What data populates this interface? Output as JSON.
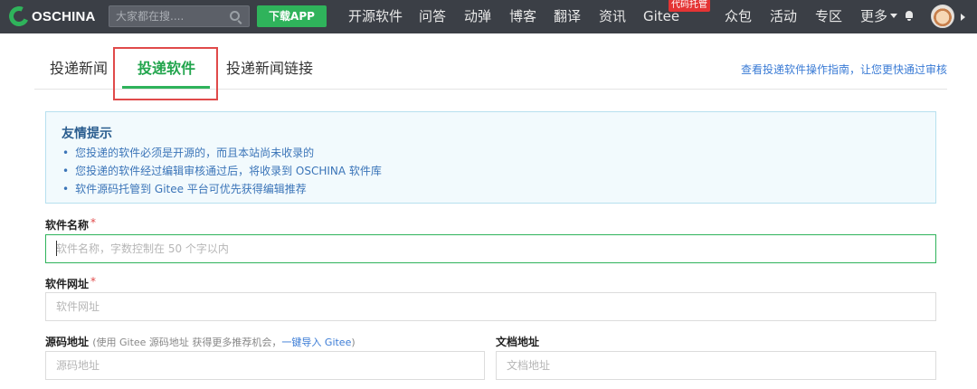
{
  "topnav": {
    "logo_text": "OSCHINA",
    "search_placeholder": "大家都在搜....",
    "download_label": "下载APP",
    "items": [
      "开源软件",
      "问答",
      "动弹",
      "博客",
      "翻译",
      "资讯",
      "Gitee",
      "众包",
      "活动",
      "专区",
      "更多"
    ],
    "gitee_badge": "代码托管"
  },
  "tabs": {
    "items": [
      "投递新闻",
      "投递软件",
      "投递新闻链接"
    ],
    "active_index": 1,
    "guide_link": "查看投递软件操作指南，让您更快通过审核"
  },
  "notice": {
    "title": "友情提示",
    "items": [
      "您投递的软件必须是开源的，而且本站尚未收录的",
      "您投递的软件经过编辑审核通过后，将收录到 OSCHINA 软件库",
      "软件源码托管到 Gitee 平台可优先获得编辑推荐"
    ]
  },
  "form": {
    "name": {
      "label": "软件名称",
      "required_mark": "*",
      "placeholder": "软件名称，字数控制在 50 个字以内"
    },
    "url": {
      "label": "软件网址",
      "required_mark": "*",
      "placeholder": "软件网址"
    },
    "repo": {
      "label": "源码地址",
      "hint_prefix": "(使用 Gitee 源码地址 获得更多推荐机会，",
      "hint_link": "一键导入 Gitee",
      "hint_suffix": ")",
      "placeholder": "源码地址"
    },
    "docs": {
      "label": "文档地址",
      "placeholder": "文档地址"
    }
  },
  "colors": {
    "brand_green": "#2fb35b",
    "nav_bg": "#3b3f46",
    "link_blue": "#3a7bd5",
    "highlight_red": "#e04a4a"
  }
}
